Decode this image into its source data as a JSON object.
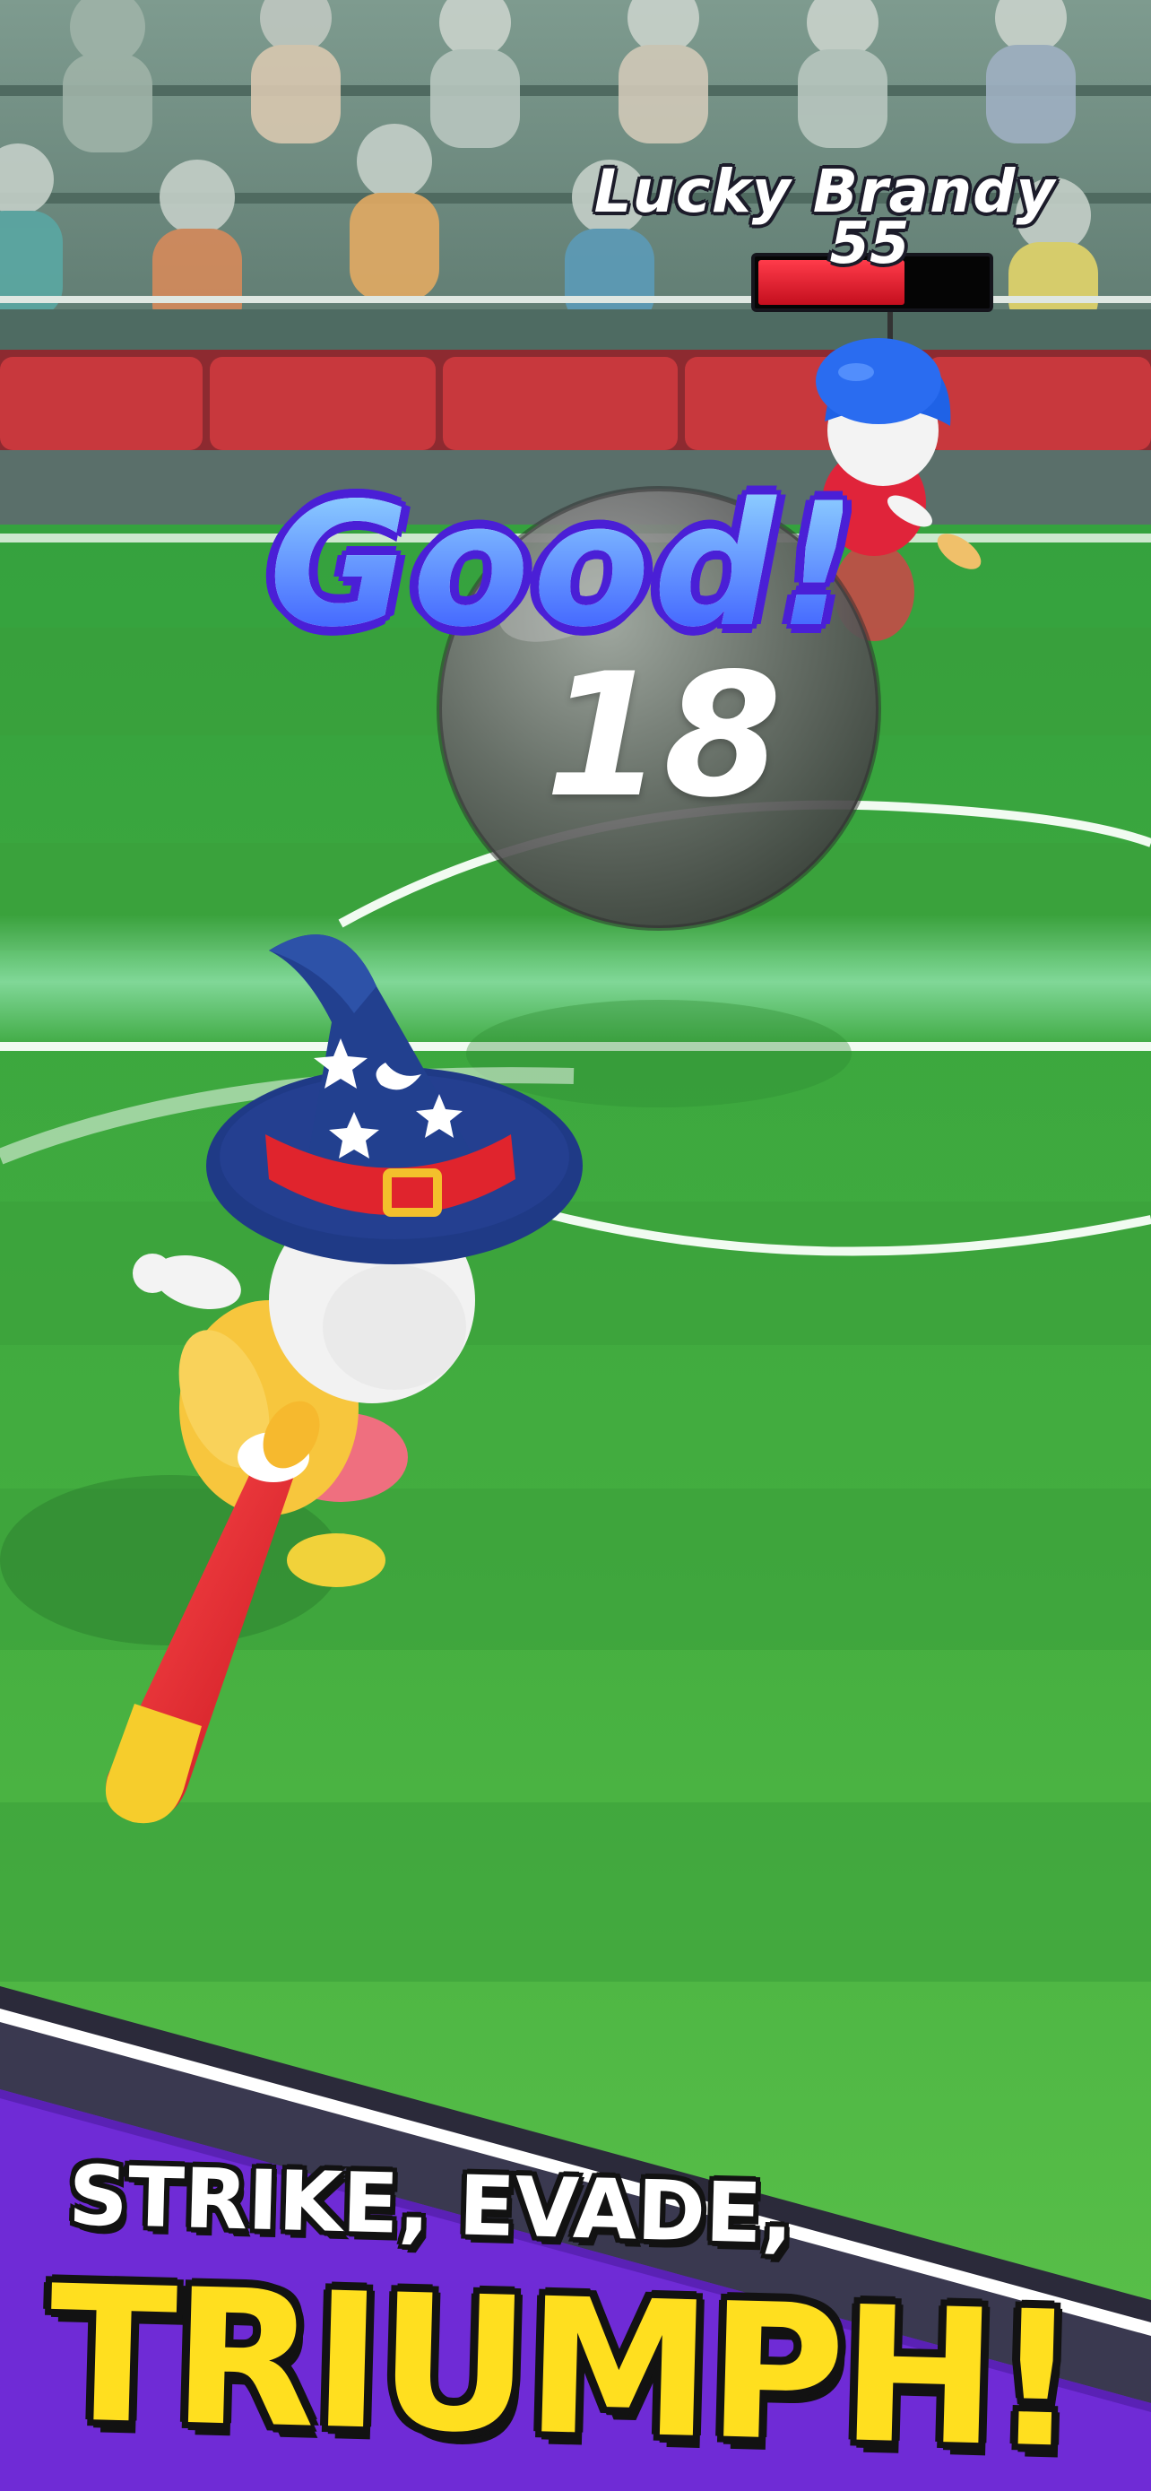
{
  "opponent": {
    "name": "Lucky Brandy",
    "hp": "55",
    "hp_fraction": 0.64
  },
  "feedback": {
    "rating": "Good!"
  },
  "ball": {
    "number": "18"
  },
  "banner": {
    "line1": "STRIKE, EVADE,",
    "line2": "TRIUMPH!"
  },
  "colors": {
    "pitch": "#3fa63a",
    "banner_purple": "#6f2bd6",
    "banner_yellow": "#ffdf1f",
    "hp_red": "#e0182b"
  }
}
